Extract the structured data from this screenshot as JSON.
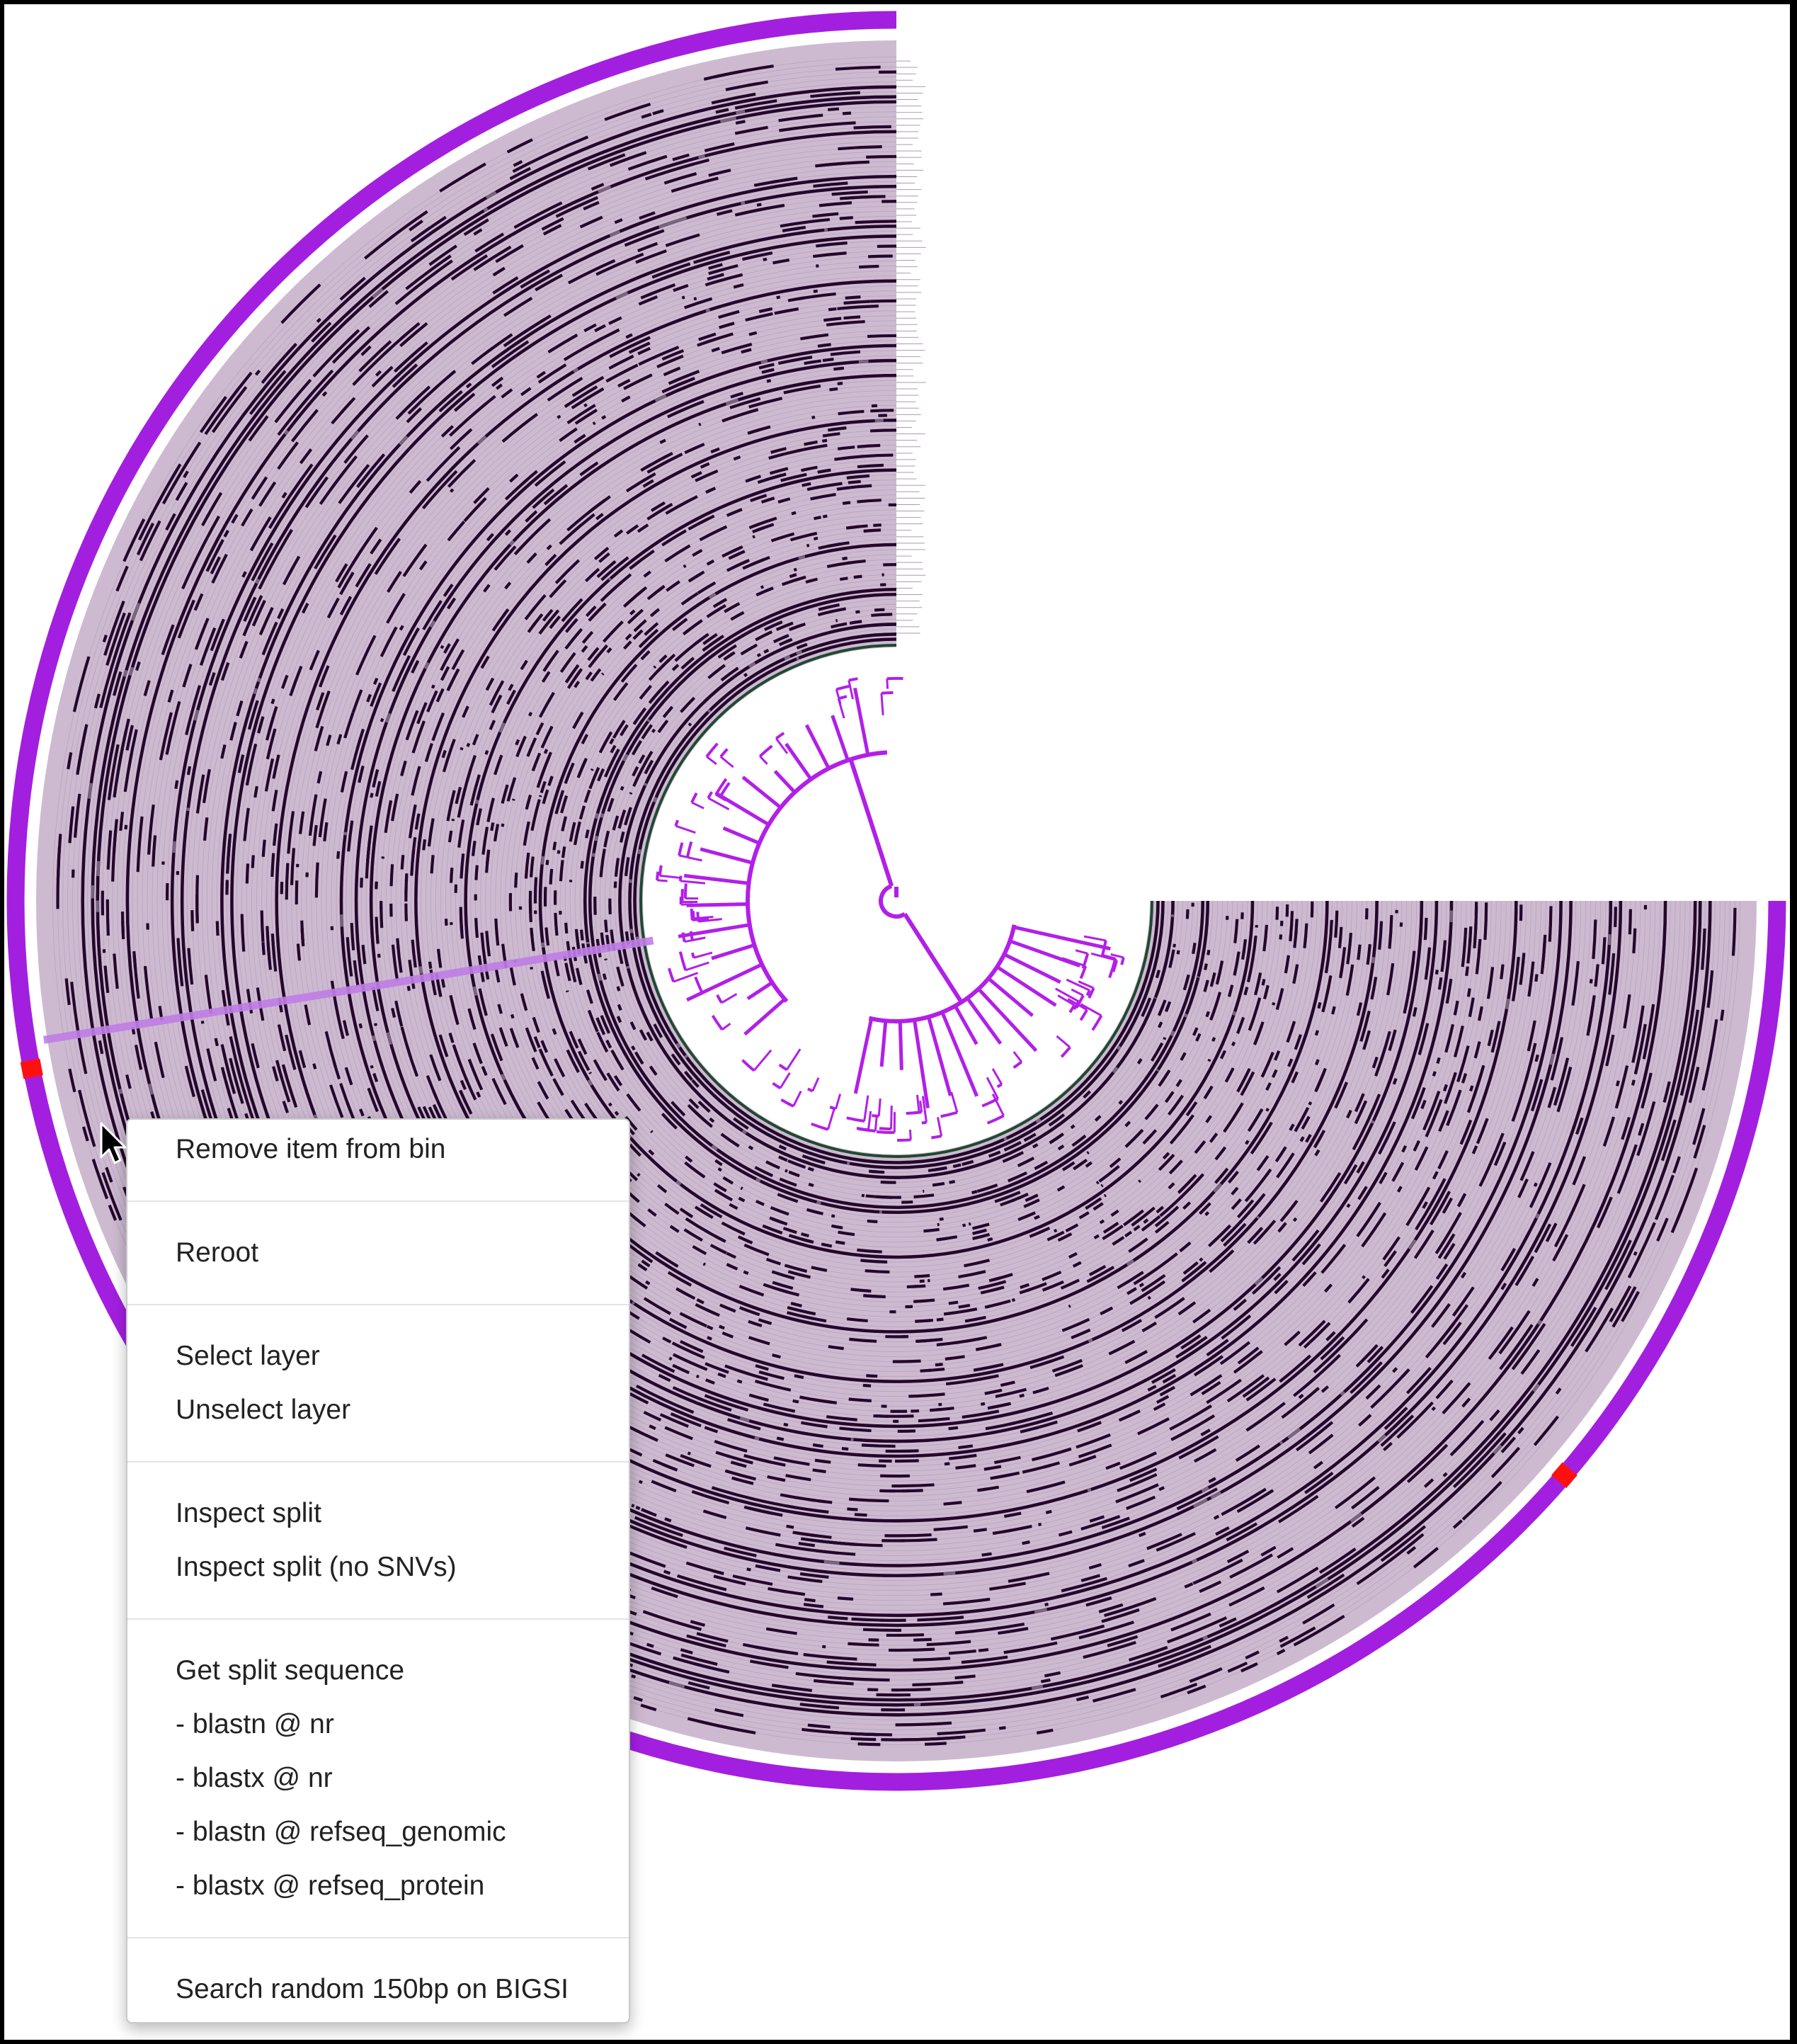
{
  "colors": {
    "accent": "#a31fe0",
    "ring_background": "#cdbad1",
    "track_dark": "#24082c",
    "tree": "#b21fe8",
    "marker": "#ff1010",
    "hover_highlight": "#c07ee6"
  },
  "cursor": {
    "icon": "mouse-pointer-icon"
  },
  "context_menu": {
    "groups": [
      {
        "items": [
          {
            "name": "remove-item-from-bin",
            "label": "Remove item from bin"
          }
        ]
      },
      {
        "items": [
          {
            "name": "reroot",
            "label": "Reroot"
          }
        ]
      },
      {
        "items": [
          {
            "name": "select-layer",
            "label": "Select layer"
          },
          {
            "name": "unselect-layer",
            "label": "Unselect layer"
          }
        ]
      },
      {
        "items": [
          {
            "name": "inspect-split",
            "label": "Inspect split"
          },
          {
            "name": "inspect-split-no-snvs",
            "label": "Inspect split (no SNVs)"
          }
        ]
      },
      {
        "items": [
          {
            "name": "get-split-sequence",
            "label": "Get split sequence"
          },
          {
            "name": "blastn-nr",
            "label": "- blastn @ nr"
          },
          {
            "name": "blastx-nr",
            "label": "- blastx @ nr"
          },
          {
            "name": "blastn-refseq-genomic",
            "label": "- blastn @ refseq_genomic"
          },
          {
            "name": "blastx-refseq-protein",
            "label": "- blastx @ refseq_protein"
          }
        ]
      },
      {
        "items": [
          {
            "name": "search-bigsi",
            "label": "Search random 150bp on BIGSI"
          }
        ]
      }
    ]
  }
}
